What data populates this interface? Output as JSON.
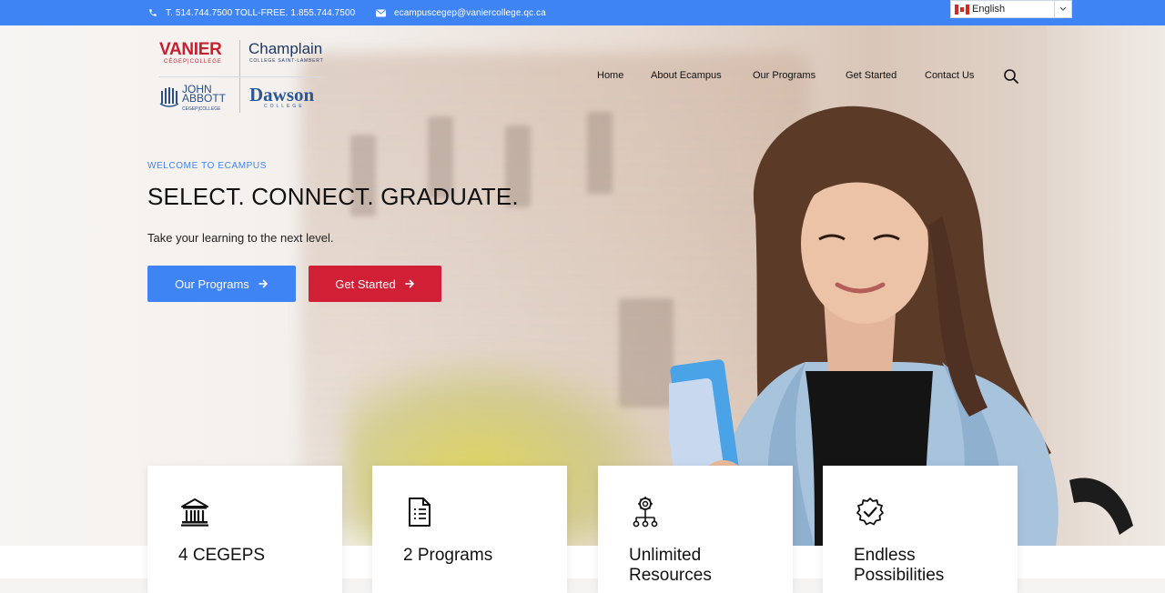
{
  "topbar": {
    "phone": "T. 514.744.7500 TOLL-FREE. 1.855.744.7500",
    "email": "ecampuscegep@vaniercollege.qc.ca",
    "language": "English"
  },
  "logos": {
    "vanier": "VANIER",
    "vanier_sub": "CÉGEP|COLLEGE",
    "champlain": "Champlain",
    "champlain_sub": "COLLEGE SAINT-LAMBERT",
    "john_abbott_1": "JOHN",
    "john_abbott_2": "ABBOTT",
    "john_abbott_sub": "CEGEP|COLLEGE",
    "dawson": "Dawson",
    "dawson_sub": "COLLEGE"
  },
  "nav": {
    "items": [
      {
        "label": "Home"
      },
      {
        "label": "About Ecampus"
      },
      {
        "label": "Our Programs"
      },
      {
        "label": "Get Started"
      },
      {
        "label": "Contact Us"
      }
    ]
  },
  "hero": {
    "eyebrow": "WELCOME TO ECAMPUS",
    "title": "SELECT. CONNECT. GRADUATE.",
    "lead": "Take your learning to the next level.",
    "btn_programs": "Our Programs",
    "btn_started": "Get Started"
  },
  "colors": {
    "accent_blue": "#3f84f4",
    "accent_red": "#d11f35"
  },
  "cards": [
    {
      "icon": "institution-icon",
      "title": "4 CEGEPS"
    },
    {
      "icon": "document-icon",
      "title": "2 Programs"
    },
    {
      "icon": "network-gear-icon",
      "title": "Unlimited Resources"
    },
    {
      "icon": "badge-check-icon",
      "title": "Endless Possibilities"
    }
  ]
}
